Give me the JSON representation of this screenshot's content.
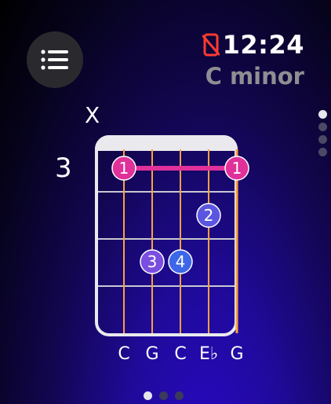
{
  "status": {
    "time": "12:24",
    "no_phone_icon": "phone-disconnected-icon",
    "icon_color": "#ff3b30"
  },
  "chord": {
    "name": "C minor",
    "fret_position": "3",
    "muted_marker": "X",
    "strings": [
      "C",
      "G",
      "C",
      "E♭",
      "G"
    ],
    "fingers": [
      {
        "label": "1",
        "string": 1,
        "fret": 1,
        "color": "#e0309a"
      },
      {
        "label": "1",
        "string": 5,
        "fret": 1,
        "color": "#e0309a"
      },
      {
        "label": "2",
        "string": 4,
        "fret": 2,
        "color": "#5b56e0"
      },
      {
        "label": "3",
        "string": 2,
        "fret": 3,
        "color": "#7a4ee0"
      },
      {
        "label": "4",
        "string": 3,
        "fret": 3,
        "color": "#3c67e8"
      }
    ],
    "barre": {
      "from_string": 1,
      "to_string": 5,
      "fret": 1,
      "color": "#e0309a"
    }
  },
  "colors": {
    "string": "#ff9f40",
    "fret": "#c8c8d0",
    "muted_label": "#8e8e93"
  },
  "pagination": {
    "vertical_count": 4,
    "vertical_active": 0,
    "horizontal_count": 3,
    "horizontal_active": 0
  }
}
